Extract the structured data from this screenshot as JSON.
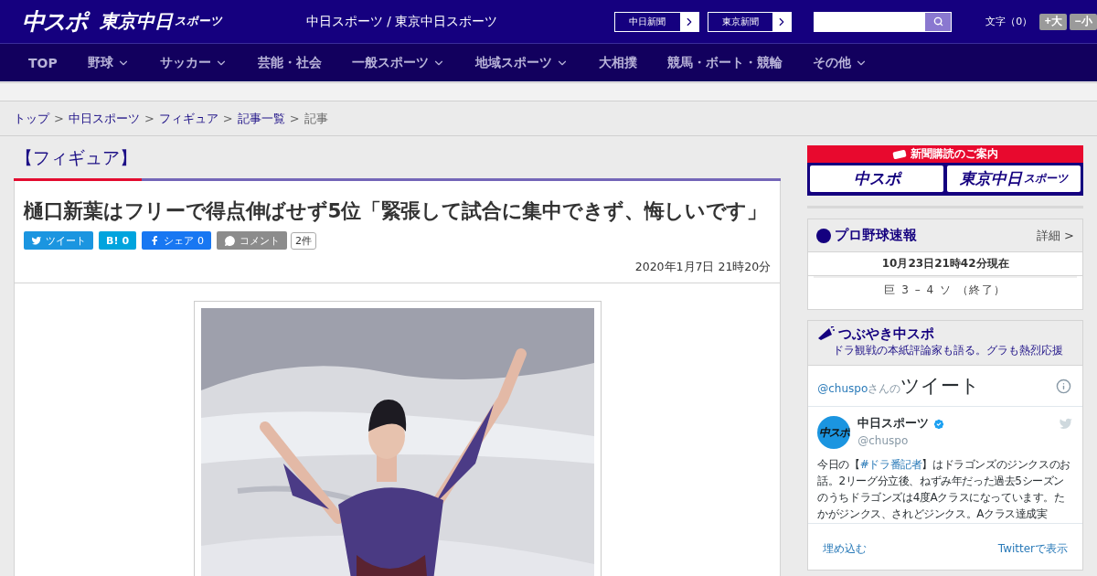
{
  "header": {
    "logo_main": "中スポ",
    "logo_tokyo": "東京中日",
    "logo_tokyo_small": "スポーツ",
    "site_title": "中日スポーツ / 東京中日スポーツ",
    "paper_links": [
      "中日新聞",
      "東京新聞"
    ],
    "font_size_label": "文字（0）",
    "font_buttons": [
      "+大",
      "−小"
    ]
  },
  "nav": [
    {
      "label": "TOP",
      "dropdown": false
    },
    {
      "label": "野球",
      "dropdown": true
    },
    {
      "label": "サッカー",
      "dropdown": true
    },
    {
      "label": "芸能・社会",
      "dropdown": false
    },
    {
      "label": "一般スポーツ",
      "dropdown": true
    },
    {
      "label": "地域スポーツ",
      "dropdown": true
    },
    {
      "label": "大相撲",
      "dropdown": false
    },
    {
      "label": "競馬・ボート・競輪",
      "dropdown": false
    },
    {
      "label": "その他",
      "dropdown": true
    }
  ],
  "breadcrumb": [
    {
      "label": "トップ",
      "link": true
    },
    {
      "sep": ">",
      "label": "中日スポーツ",
      "link": true
    },
    {
      "sep": ">",
      "label": "フィギュア",
      "link": true
    },
    {
      "sep": ">",
      "label": "記事一覧",
      "link": true
    },
    {
      "sep": ">",
      "label": "記事",
      "link": false
    }
  ],
  "article": {
    "category": "【フィギュア】",
    "title": "樋口新葉はフリーで得点伸ばせず5位「緊張して試合に集中できず、悔しいです」",
    "share": [
      {
        "kind": "twitter",
        "label": "ツイート"
      },
      {
        "kind": "hatena",
        "label": "B!",
        "count": "0"
      },
      {
        "kind": "facebook",
        "label": "シェア",
        "count": "0"
      },
      {
        "kind": "comment",
        "label": "コメント"
      }
    ],
    "comment_count": "2件",
    "date": "2020年1月7日 21時20分"
  },
  "sidebar": {
    "subscribe": {
      "title": "新聞購読のご案内",
      "logo_main": "中スポ",
      "logo_tokyo": "東京中日",
      "logo_tokyo_small": "スポーツ"
    },
    "baseball": {
      "title": "プロ野球速報",
      "more": "詳細 >",
      "updated": "10月23日21時42分現在",
      "score": "巨 3 – 4 ソ （終了）"
    },
    "tweets": {
      "title": "つぶやき中スポ",
      "subtitle": "ドラ観戦の本紙評論家も語る。グラも熱烈応援",
      "handle_link": "@chuspo",
      "handle_suffix": "さんの",
      "heading": "ツイート",
      "avatar_text": "中スポ",
      "account": "中日スポーツ",
      "verified": true,
      "account_handle": "@chuspo",
      "text_before": "今日の【",
      "hashtag": "#ドラ番記者",
      "text_after": "】はドラゴンズのジンクスのお話。2リーグ分立後、ねずみ年だった過去5シーズンのうちドラゴンズは4度Aクラスになっています。たかがジンクス、されどジンクス。Aクラス達成実",
      "footer": [
        "埋め込む",
        "Twitterで表示"
      ]
    }
  }
}
